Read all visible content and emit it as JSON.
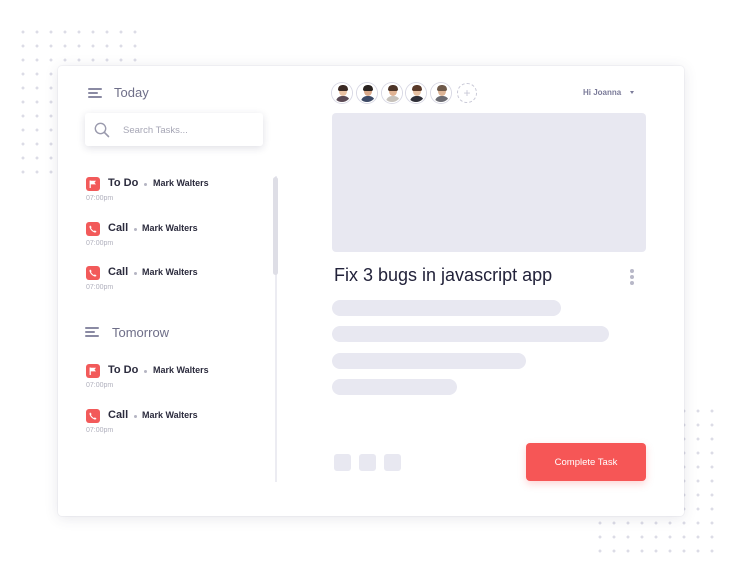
{
  "sidebar": {
    "today": {
      "title": "Today",
      "tasks": [
        {
          "type": "To Do",
          "person": "Mark Walters",
          "time": "07:00pm",
          "icon": "flag-icon"
        },
        {
          "type": "Call",
          "person": "Mark Walters",
          "time": "07:00pm",
          "icon": "phone-icon"
        },
        {
          "type": "Call",
          "person": "Mark Walters",
          "time": "07:00pm",
          "icon": "phone-icon"
        }
      ]
    },
    "tomorrow": {
      "title": "Tomorrow",
      "tasks": [
        {
          "type": "To Do",
          "person": "Mark Walters",
          "time": "07:00pm",
          "icon": "flag-icon"
        },
        {
          "type": "Call",
          "person": "Mark Walters",
          "time": "07:00pm",
          "icon": "phone-icon"
        }
      ]
    }
  },
  "search": {
    "placeholder": "Search Tasks..."
  },
  "header": {
    "greeting": "Hi Joanna",
    "avatars": [
      "avatar",
      "avatar",
      "avatar",
      "avatar",
      "avatar"
    ],
    "add_label": "+"
  },
  "detail": {
    "title": "Fix 3 bugs in javascript app",
    "complete_button": "Complete Task"
  },
  "colors": {
    "accent": "#f65656",
    "icon_red": "#f25a5a",
    "placeholder_gray": "#e8e8f1",
    "text_dark": "#22223a",
    "text_muted": "#6e6e88"
  }
}
